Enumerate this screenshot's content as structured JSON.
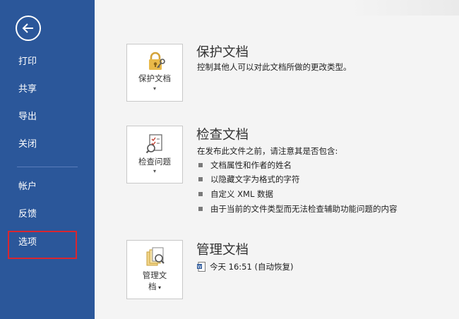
{
  "sidebar": {
    "items": [
      {
        "label": "打印"
      },
      {
        "label": "共享"
      },
      {
        "label": "导出"
      },
      {
        "label": "关闭"
      },
      {
        "label": "帐户"
      },
      {
        "label": "反馈"
      },
      {
        "label": "选项"
      }
    ]
  },
  "sections": [
    {
      "title": "保护文档",
      "tile_label": "保护文档",
      "description": "控制其他人可以对此文档所做的更改类型。"
    },
    {
      "title": "检查文档",
      "tile_label": "检查问题",
      "description": "在发布此文件之前，请注意其是否包含:",
      "bullets": [
        "文档属性和作者的姓名",
        "以隐藏文字为格式的字符",
        "自定义 XML 数据",
        "由于当前的文件类型而无法检查辅助功能问题的内容"
      ]
    },
    {
      "title": "管理文档",
      "tile_label_line1": "管理文",
      "tile_label_line2": "档",
      "version": "今天 16:51 (自动恢复)"
    }
  ],
  "icons": {
    "back": "back-arrow-icon",
    "lock": "lock-icon",
    "inspect": "inspect-document-icon",
    "manage": "manage-document-icon",
    "word": "word-file-icon"
  },
  "colors": {
    "sidebar": "#2b579a",
    "highlight": "#d9262f",
    "lock": "#e9b949"
  }
}
